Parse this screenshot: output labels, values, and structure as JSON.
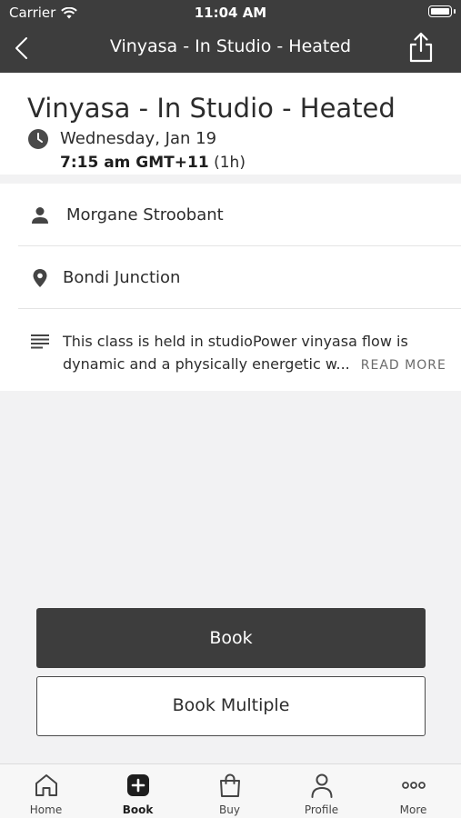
{
  "status_bar": {
    "carrier": "Carrier",
    "time": "11:04 AM"
  },
  "nav": {
    "title": "Vinyasa - In Studio - Heated"
  },
  "class": {
    "title": "Vinyasa - In Studio - Heated",
    "date": "Wednesday, Jan 19",
    "time": "7:15 am GMT+11",
    "duration": "(1h)"
  },
  "details": {
    "instructor": "Morgane Stroobant",
    "location": "Bondi Junction",
    "description_line1": "This class is held in studioPower vinyasa flow is",
    "description_line2": "dynamic and a physically energetic w...",
    "read_more": "READ MORE"
  },
  "buttons": {
    "book": "Book",
    "book_multiple": "Book Multiple"
  },
  "tabs": [
    {
      "label": "Home",
      "icon": "home-icon"
    },
    {
      "label": "Book",
      "icon": "plus-square-icon"
    },
    {
      "label": "Buy",
      "icon": "shopping-bag-icon"
    },
    {
      "label": "Profile",
      "icon": "person-icon"
    },
    {
      "label": "More",
      "icon": "more-dots-icon"
    }
  ]
}
